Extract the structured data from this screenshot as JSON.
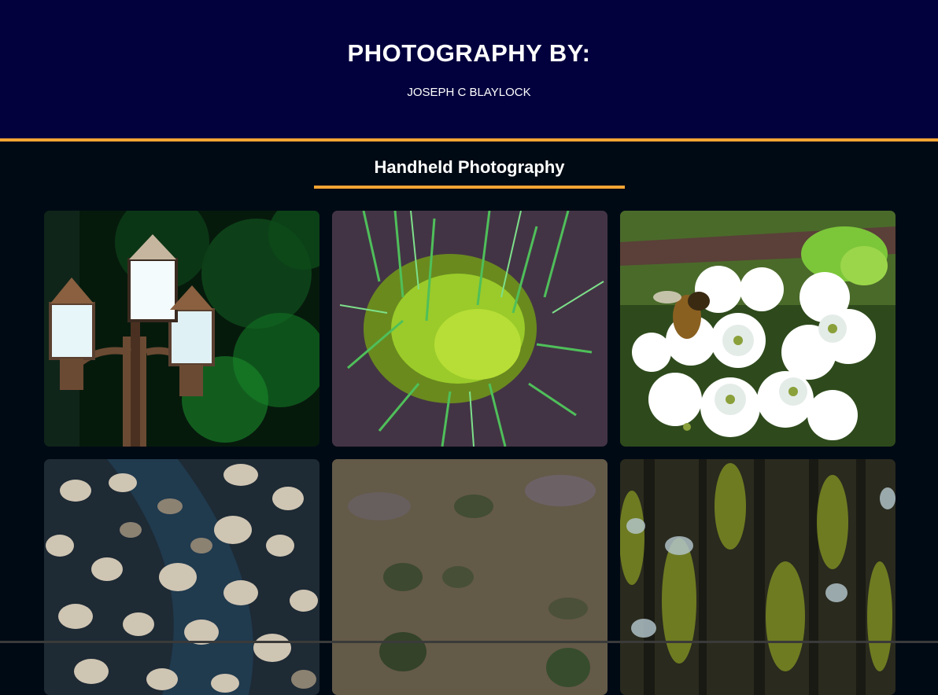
{
  "header": {
    "title": "PHOTOGRAPHY BY:",
    "author": "JOSEPH C BLAYLOCK"
  },
  "section": {
    "title": "Handheld Photography"
  },
  "colors": {
    "header_bg": "#02003d",
    "page_bg": "#000a14",
    "accent": "#f4a533",
    "text": "#ffffff"
  }
}
